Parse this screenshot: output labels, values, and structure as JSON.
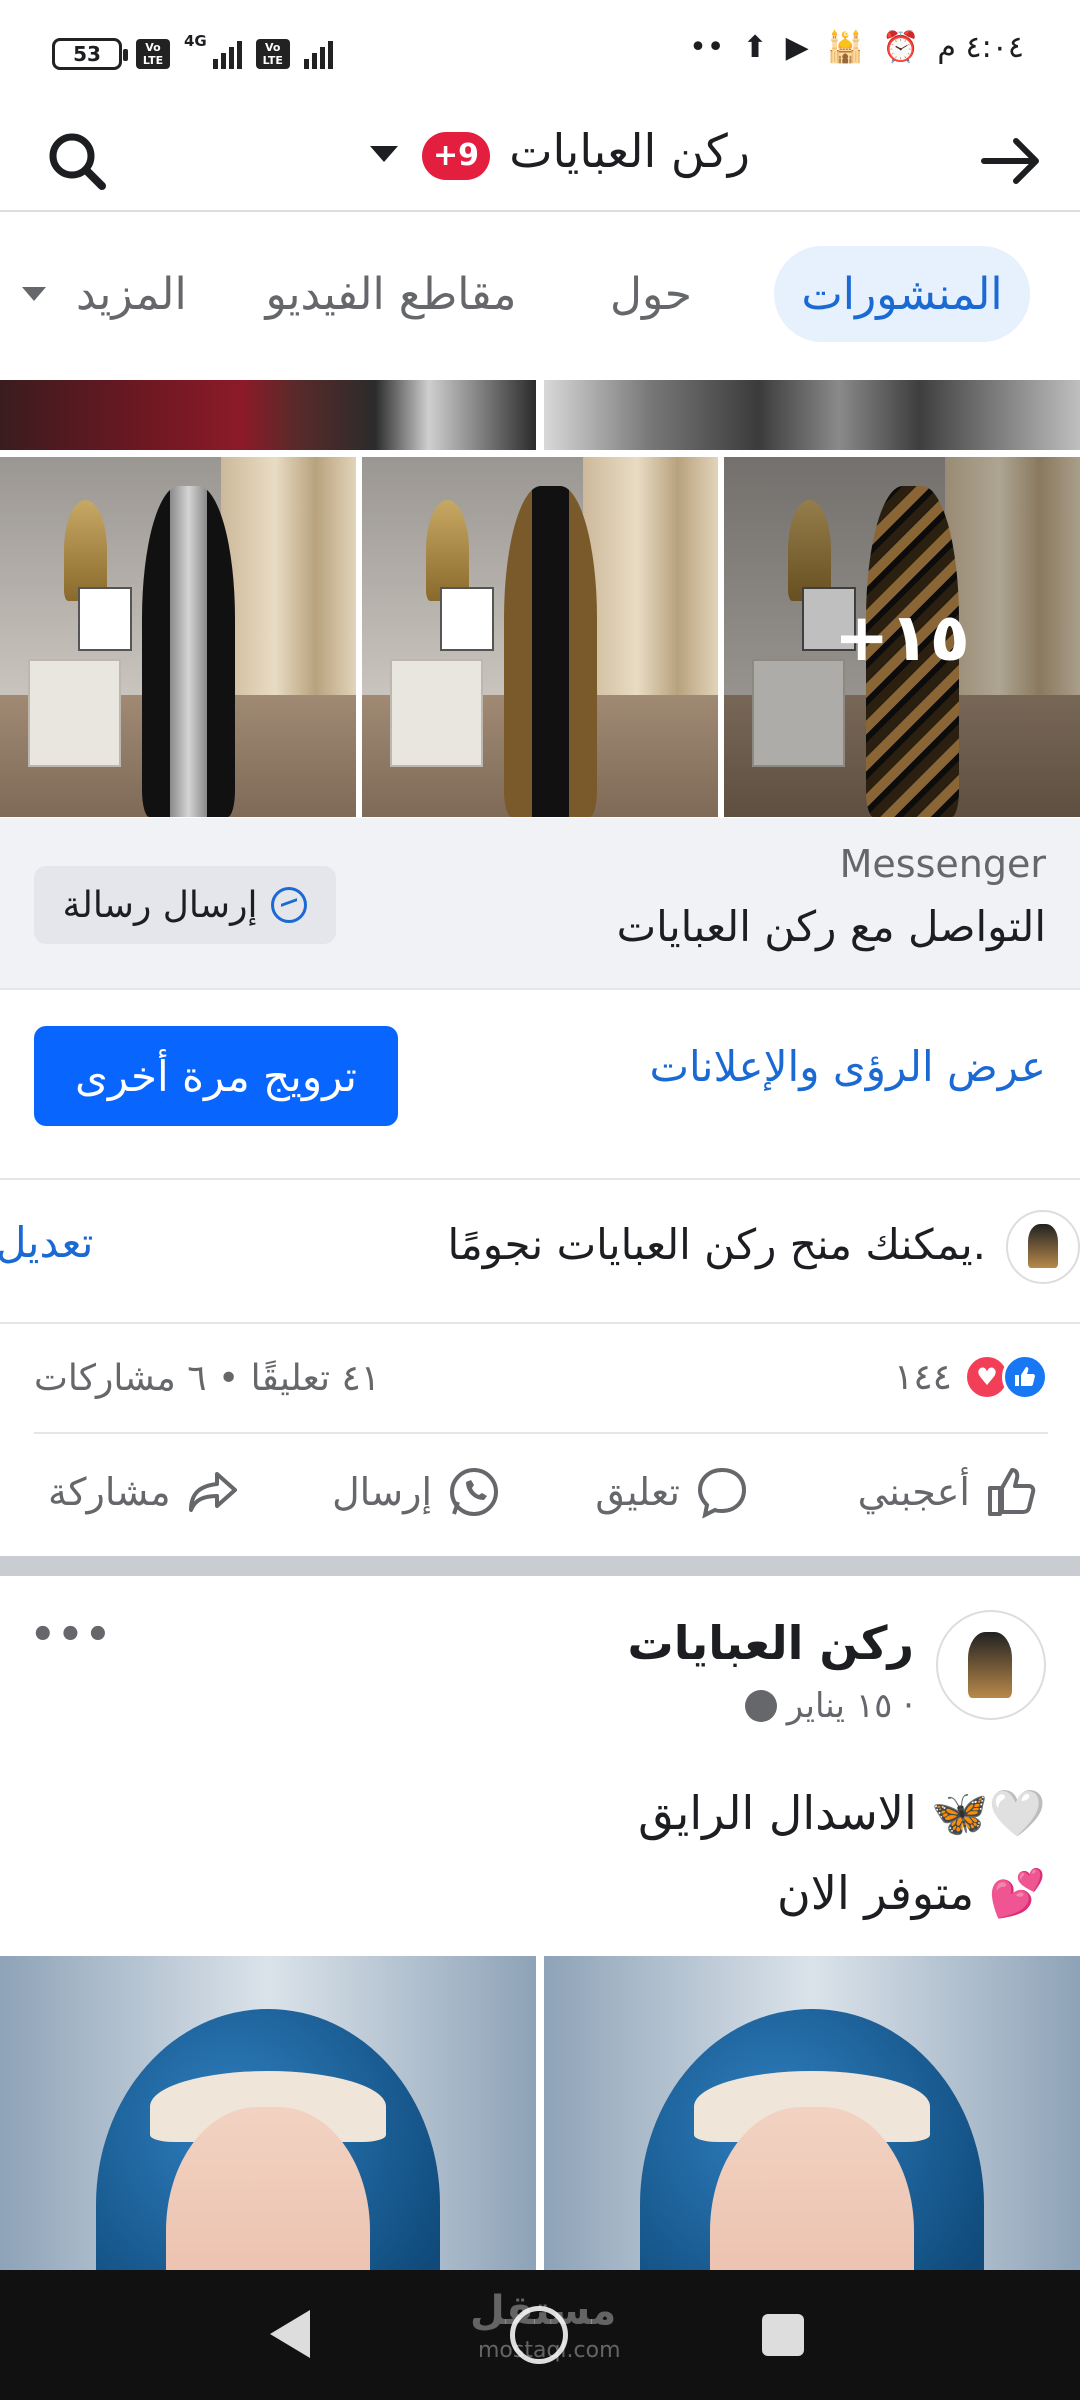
{
  "status": {
    "battery": "53",
    "volte": "Vo\nLTE",
    "network": "4G",
    "time": "٤:٠٤ م",
    "dots": "••"
  },
  "header": {
    "title": "ركن العبايات",
    "badge": "+9"
  },
  "tabs": {
    "posts": "المنشورات",
    "about": "حول",
    "videos": "مقاطع الفيديو",
    "more": "المزيد"
  },
  "photos": {
    "more_overlay": "+١٥"
  },
  "messenger": {
    "label": "Messenger",
    "subtitle": "التواصل مع ركن العبايات",
    "button": "إرسال رسالة"
  },
  "insights": {
    "link": "عرض الرؤى والإعلانات",
    "boost": "ترويج مرة أخرى"
  },
  "stars": {
    "text": "يمكنك منح ركن العبايات نجومًا.",
    "edit": "تعديل"
  },
  "reactions": {
    "count": "١٤٤",
    "meta": "٤١ تعليقًا • ٦ مشاركات"
  },
  "actions": {
    "like": "أعجبني",
    "comment": "تعليق",
    "send": "إرسال",
    "share": "مشاركة"
  },
  "post2": {
    "name": "ركن العبايات",
    "date": "١٥ يناير ·",
    "line1": "الاسدال الرايق 🦋🤍",
    "line2": "متوفر الان 💕",
    "menu": "•••"
  },
  "watermark": {
    "line1": "مستقل",
    "line2": "mostaql.com"
  },
  "colors": {
    "accent": "#1b6ad4",
    "boost": "#0866ff",
    "badge": "#e41e3f"
  }
}
